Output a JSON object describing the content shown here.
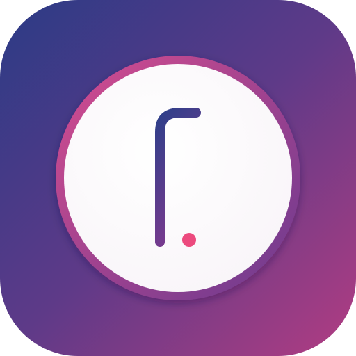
{
  "app_icon": {
    "glyph": "f",
    "icon_name": "f-dot-logo-icon",
    "colors": {
      "gradient_start": "#2b3b86",
      "gradient_mid": "#5e3a88",
      "gradient_end": "#b23d82",
      "ring_start": "#d64c8f",
      "ring_end": "#6a3a8f",
      "disc": "#f8f4f8",
      "glyph_start": "#2f3f8a",
      "glyph_end": "#7b3a8e",
      "dot": "#ec4a7e"
    }
  }
}
